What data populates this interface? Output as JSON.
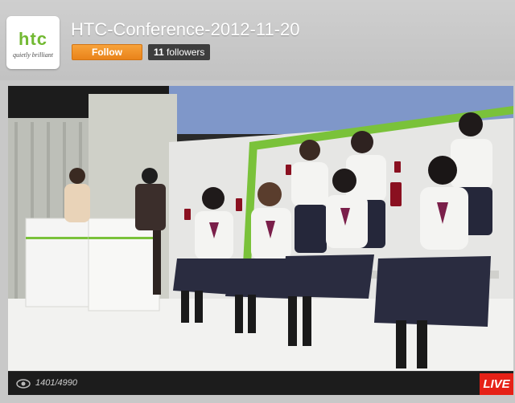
{
  "channel": {
    "logo_word": "htc",
    "logo_tagline": "quietly brilliant",
    "title": "HTC-Conference-2012-11-20",
    "follow_label": "Follow",
    "followers_count": "11",
    "followers_label": "followers"
  },
  "player": {
    "viewers_text": "1401/4990",
    "live_label": "LIVE"
  },
  "colors": {
    "brand_green": "#72b932",
    "follow_orange": "#f08f28",
    "live_red": "#e62117"
  }
}
